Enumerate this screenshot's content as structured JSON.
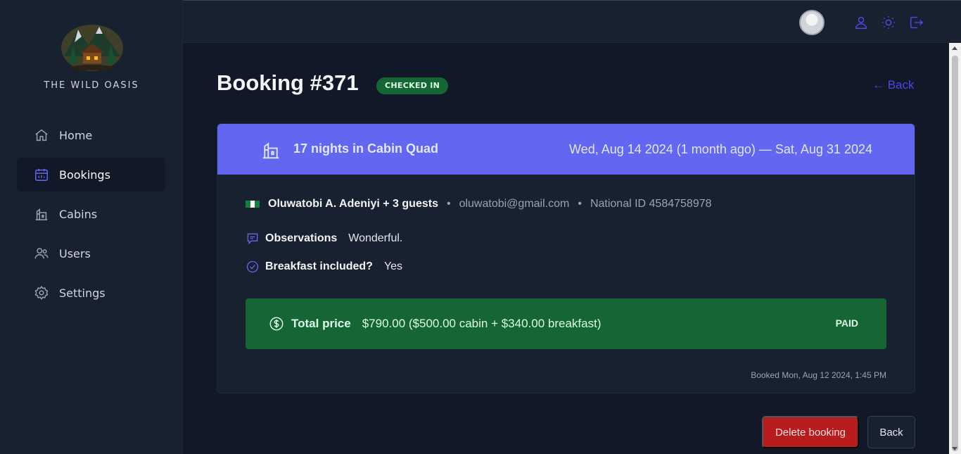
{
  "sidebar": {
    "brand": "THE WILD OASIS",
    "items": [
      {
        "label": "Home",
        "icon": "home-icon",
        "active": false
      },
      {
        "label": "Bookings",
        "icon": "calendar-icon",
        "active": true
      },
      {
        "label": "Cabins",
        "icon": "cabin-icon",
        "active": false
      },
      {
        "label": "Users",
        "icon": "users-icon",
        "active": false
      },
      {
        "label": "Settings",
        "icon": "settings-icon",
        "active": false
      }
    ]
  },
  "header": {
    "icons": [
      "user-icon",
      "sun-icon",
      "logout-icon"
    ]
  },
  "booking": {
    "title": "Booking #371",
    "status": "CHECKED IN",
    "back_link": "← Back",
    "nights": "17 nights in Cabin  Quad",
    "dates": "Wed, Aug 14 2024 (1 month ago) — Sat, Aug 31 2024",
    "guest_name": "Oluwatobi A. Adeniyi + 3 guests",
    "guest_email": "oluwatobi@gmail.com",
    "national_id": "National ID 4584758978",
    "observations_label": "Observations",
    "observations_value": "Wonderful.",
    "breakfast_label": "Breakfast included?",
    "breakfast_value": "Yes",
    "price_label": "Total price",
    "price_value": "$790.00 ($500.00 cabin + $340.00 breakfast)",
    "paid_label": "PAID",
    "booked_at": "Booked Mon, Aug 12 2024, 1:45 PM"
  },
  "buttons": {
    "delete": "Delete booking",
    "back": "Back"
  },
  "colors": {
    "accent": "#6366f1",
    "link": "#4f46e5",
    "success": "#166534",
    "danger": "#b91c1c",
    "sidebar_bg": "#18212f",
    "page_bg": "#111827"
  }
}
